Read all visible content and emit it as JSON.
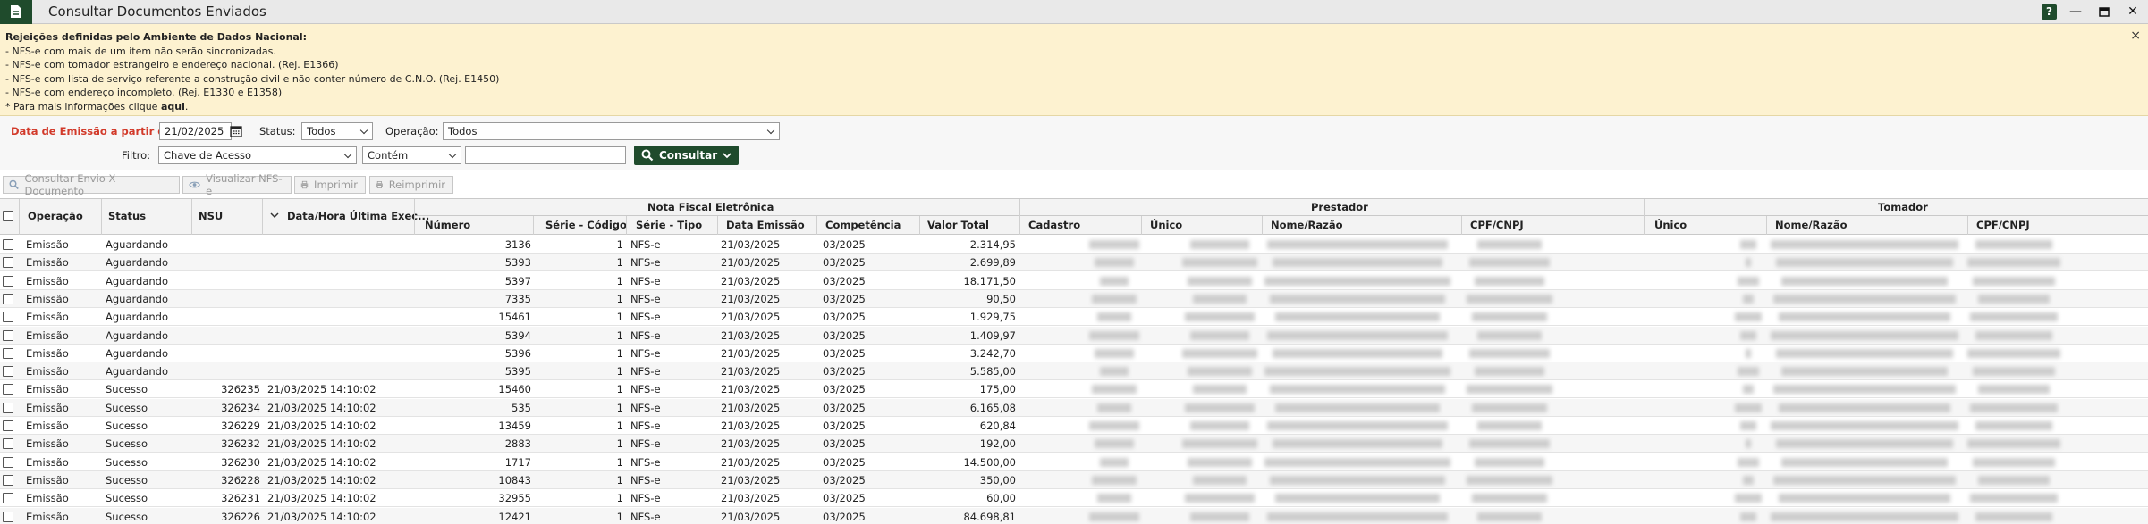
{
  "window": {
    "title": "Consultar Documentos Enviados",
    "help_label": "?",
    "minimize_label": "—",
    "maximize_label": "☐",
    "close_label": "✕"
  },
  "banner": {
    "heading": "Rejeições definidas pelo Ambiente de Dados Nacional:",
    "lines": [
      "- NFS-e com mais de um item não serão sincronizadas.",
      "- NFS-e com tomador estrangeiro e endereço nacional. (Rej. E1366)",
      "- NFS-e com lista de serviço referente a construção civil e não conter número de C.N.O. (Rej. E1450)",
      "- NFS-e com endereço incompleto. (Rej. E1330 e E1358)"
    ],
    "more_info_prefix": "* Para mais informações clique ",
    "more_info_link": "aqui",
    "more_info_suffix": ".",
    "close_label": "×"
  },
  "filters": {
    "date_label": "Data de Emissão a partir de*",
    "date_value": "21/02/2025",
    "status_label": "Status:",
    "status_value": "Todos",
    "operacao_label": "Operação:",
    "operacao_value": "Todos",
    "filtro_label": "Filtro:",
    "filtro_field_value": "Chave de Acesso",
    "filtro_mode_value": "Contém",
    "filtro_text_value": "",
    "consultar_label": "Consultar"
  },
  "toolbar": {
    "consultar_envio_label": "Consultar Envio X Documento",
    "visualizar_label": "Visualizar NFS-e",
    "imprimir_label": "Imprimir",
    "reimprimir_label": "Reimprimir"
  },
  "table": {
    "group_headers": {
      "nota": "Nota Fiscal Eletrônica",
      "prestador": "Prestador",
      "tomador": "Tomador"
    },
    "columns": {
      "operacao": "Operação",
      "status": "Status",
      "nsu": "NSU",
      "data_hora": "Data/Hora Última Exec...",
      "numero": "Número",
      "serie_codigo": "Série - Código",
      "serie_tipo": "Série - Tipo",
      "data_emissao": "Data Emissão",
      "competencia": "Competência",
      "valor_total": "Valor Total",
      "prest_cadastro": "Cadastro",
      "prest_unico": "Único",
      "prest_nome": "Nome/Razão",
      "prest_cpf": "CPF/CNPJ",
      "tom_unico": "Único",
      "tom_nome": "Nome/Razão",
      "tom_cpf": "CPF/CNPJ"
    },
    "rows": [
      {
        "operacao": "Emissão",
        "status": "Aguardando",
        "nsu": "",
        "data_hora": "",
        "numero": "3136",
        "serie_codigo": "1",
        "serie_tipo": "NFS-e",
        "data_emissao": "21/03/2025",
        "competencia": "03/2025",
        "valor_total": "2.314,95"
      },
      {
        "operacao": "Emissão",
        "status": "Aguardando",
        "nsu": "",
        "data_hora": "",
        "numero": "5393",
        "serie_codigo": "1",
        "serie_tipo": "NFS-e",
        "data_emissao": "21/03/2025",
        "competencia": "03/2025",
        "valor_total": "2.699,89"
      },
      {
        "operacao": "Emissão",
        "status": "Aguardando",
        "nsu": "",
        "data_hora": "",
        "numero": "5397",
        "serie_codigo": "1",
        "serie_tipo": "NFS-e",
        "data_emissao": "21/03/2025",
        "competencia": "03/2025",
        "valor_total": "18.171,50"
      },
      {
        "operacao": "Emissão",
        "status": "Aguardando",
        "nsu": "",
        "data_hora": "",
        "numero": "7335",
        "serie_codigo": "1",
        "serie_tipo": "NFS-e",
        "data_emissao": "21/03/2025",
        "competencia": "03/2025",
        "valor_total": "90,50"
      },
      {
        "operacao": "Emissão",
        "status": "Aguardando",
        "nsu": "",
        "data_hora": "",
        "numero": "15461",
        "serie_codigo": "1",
        "serie_tipo": "NFS-e",
        "data_emissao": "21/03/2025",
        "competencia": "03/2025",
        "valor_total": "1.929,75"
      },
      {
        "operacao": "Emissão",
        "status": "Aguardando",
        "nsu": "",
        "data_hora": "",
        "numero": "5394",
        "serie_codigo": "1",
        "serie_tipo": "NFS-e",
        "data_emissao": "21/03/2025",
        "competencia": "03/2025",
        "valor_total": "1.409,97"
      },
      {
        "operacao": "Emissão",
        "status": "Aguardando",
        "nsu": "",
        "data_hora": "",
        "numero": "5396",
        "serie_codigo": "1",
        "serie_tipo": "NFS-e",
        "data_emissao": "21/03/2025",
        "competencia": "03/2025",
        "valor_total": "3.242,70"
      },
      {
        "operacao": "Emissão",
        "status": "Aguardando",
        "nsu": "",
        "data_hora": "",
        "numero": "5395",
        "serie_codigo": "1",
        "serie_tipo": "NFS-e",
        "data_emissao": "21/03/2025",
        "competencia": "03/2025",
        "valor_total": "5.585,00"
      },
      {
        "operacao": "Emissão",
        "status": "Sucesso",
        "nsu": "326235",
        "data_hora": "21/03/2025 14:10:02",
        "numero": "15460",
        "serie_codigo": "1",
        "serie_tipo": "NFS-e",
        "data_emissao": "21/03/2025",
        "competencia": "03/2025",
        "valor_total": "175,00"
      },
      {
        "operacao": "Emissão",
        "status": "Sucesso",
        "nsu": "326234",
        "data_hora": "21/03/2025 14:10:02",
        "numero": "535",
        "serie_codigo": "1",
        "serie_tipo": "NFS-e",
        "data_emissao": "21/03/2025",
        "competencia": "03/2025",
        "valor_total": "6.165,08"
      },
      {
        "operacao": "Emissão",
        "status": "Sucesso",
        "nsu": "326229",
        "data_hora": "21/03/2025 14:10:02",
        "numero": "13459",
        "serie_codigo": "1",
        "serie_tipo": "NFS-e",
        "data_emissao": "21/03/2025",
        "competencia": "03/2025",
        "valor_total": "620,84"
      },
      {
        "operacao": "Emissão",
        "status": "Sucesso",
        "nsu": "326232",
        "data_hora": "21/03/2025 14:10:02",
        "numero": "2883",
        "serie_codigo": "1",
        "serie_tipo": "NFS-e",
        "data_emissao": "21/03/2025",
        "competencia": "03/2025",
        "valor_total": "192,00"
      },
      {
        "operacao": "Emissão",
        "status": "Sucesso",
        "nsu": "326230",
        "data_hora": "21/03/2025 14:10:02",
        "numero": "1717",
        "serie_codigo": "1",
        "serie_tipo": "NFS-e",
        "data_emissao": "21/03/2025",
        "competencia": "03/2025",
        "valor_total": "14.500,00"
      },
      {
        "operacao": "Emissão",
        "status": "Sucesso",
        "nsu": "326228",
        "data_hora": "21/03/2025 14:10:02",
        "numero": "10843",
        "serie_codigo": "1",
        "serie_tipo": "NFS-e",
        "data_emissao": "21/03/2025",
        "competencia": "03/2025",
        "valor_total": "350,00"
      },
      {
        "operacao": "Emissão",
        "status": "Sucesso",
        "nsu": "326231",
        "data_hora": "21/03/2025 14:10:02",
        "numero": "32955",
        "serie_codigo": "1",
        "serie_tipo": "NFS-e",
        "data_emissao": "21/03/2025",
        "competencia": "03/2025",
        "valor_total": "60,00"
      },
      {
        "operacao": "Emissão",
        "status": "Sucesso",
        "nsu": "326226",
        "data_hora": "21/03/2025 14:10:02",
        "numero": "12421",
        "serie_codigo": "1",
        "serie_tipo": "NFS-e",
        "data_emissao": "21/03/2025",
        "competencia": "03/2025",
        "valor_total": "84.698,81"
      }
    ]
  },
  "colors": {
    "brand": "#1f4b2c",
    "banner_bg": "#fdf2d0",
    "required_label": "#d23a2a"
  },
  "icons": {
    "app": "document-icon",
    "calendar": "calendar-icon",
    "search": "search-icon",
    "eye": "eye-icon",
    "print": "printer-icon",
    "sort": "chevron-down-icon"
  }
}
